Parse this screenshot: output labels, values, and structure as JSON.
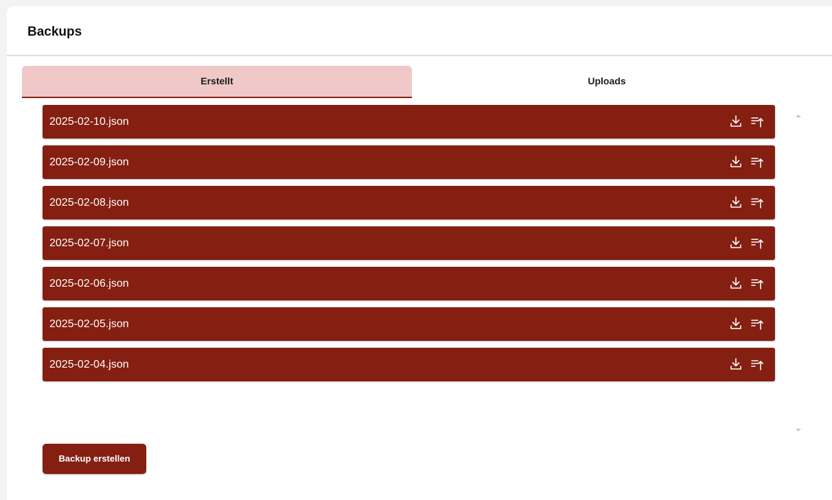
{
  "header": {
    "title": "Backups"
  },
  "tabs": [
    {
      "label": "Erstellt",
      "active": true
    },
    {
      "label": "Uploads",
      "active": false
    }
  ],
  "backups": [
    {
      "filename": "2025-02-10.json"
    },
    {
      "filename": "2025-02-09.json"
    },
    {
      "filename": "2025-02-08.json"
    },
    {
      "filename": "2025-02-07.json"
    },
    {
      "filename": "2025-02-06.json"
    },
    {
      "filename": "2025-02-05.json"
    },
    {
      "filename": "2025-02-04.json"
    }
  ],
  "row_icons": {
    "download": "download-icon",
    "restore": "restore-icon"
  },
  "actions": {
    "create_label": "Backup erstellen"
  },
  "colors": {
    "accent": "#841f12",
    "tab_active_bg": "#f0c8c8"
  }
}
